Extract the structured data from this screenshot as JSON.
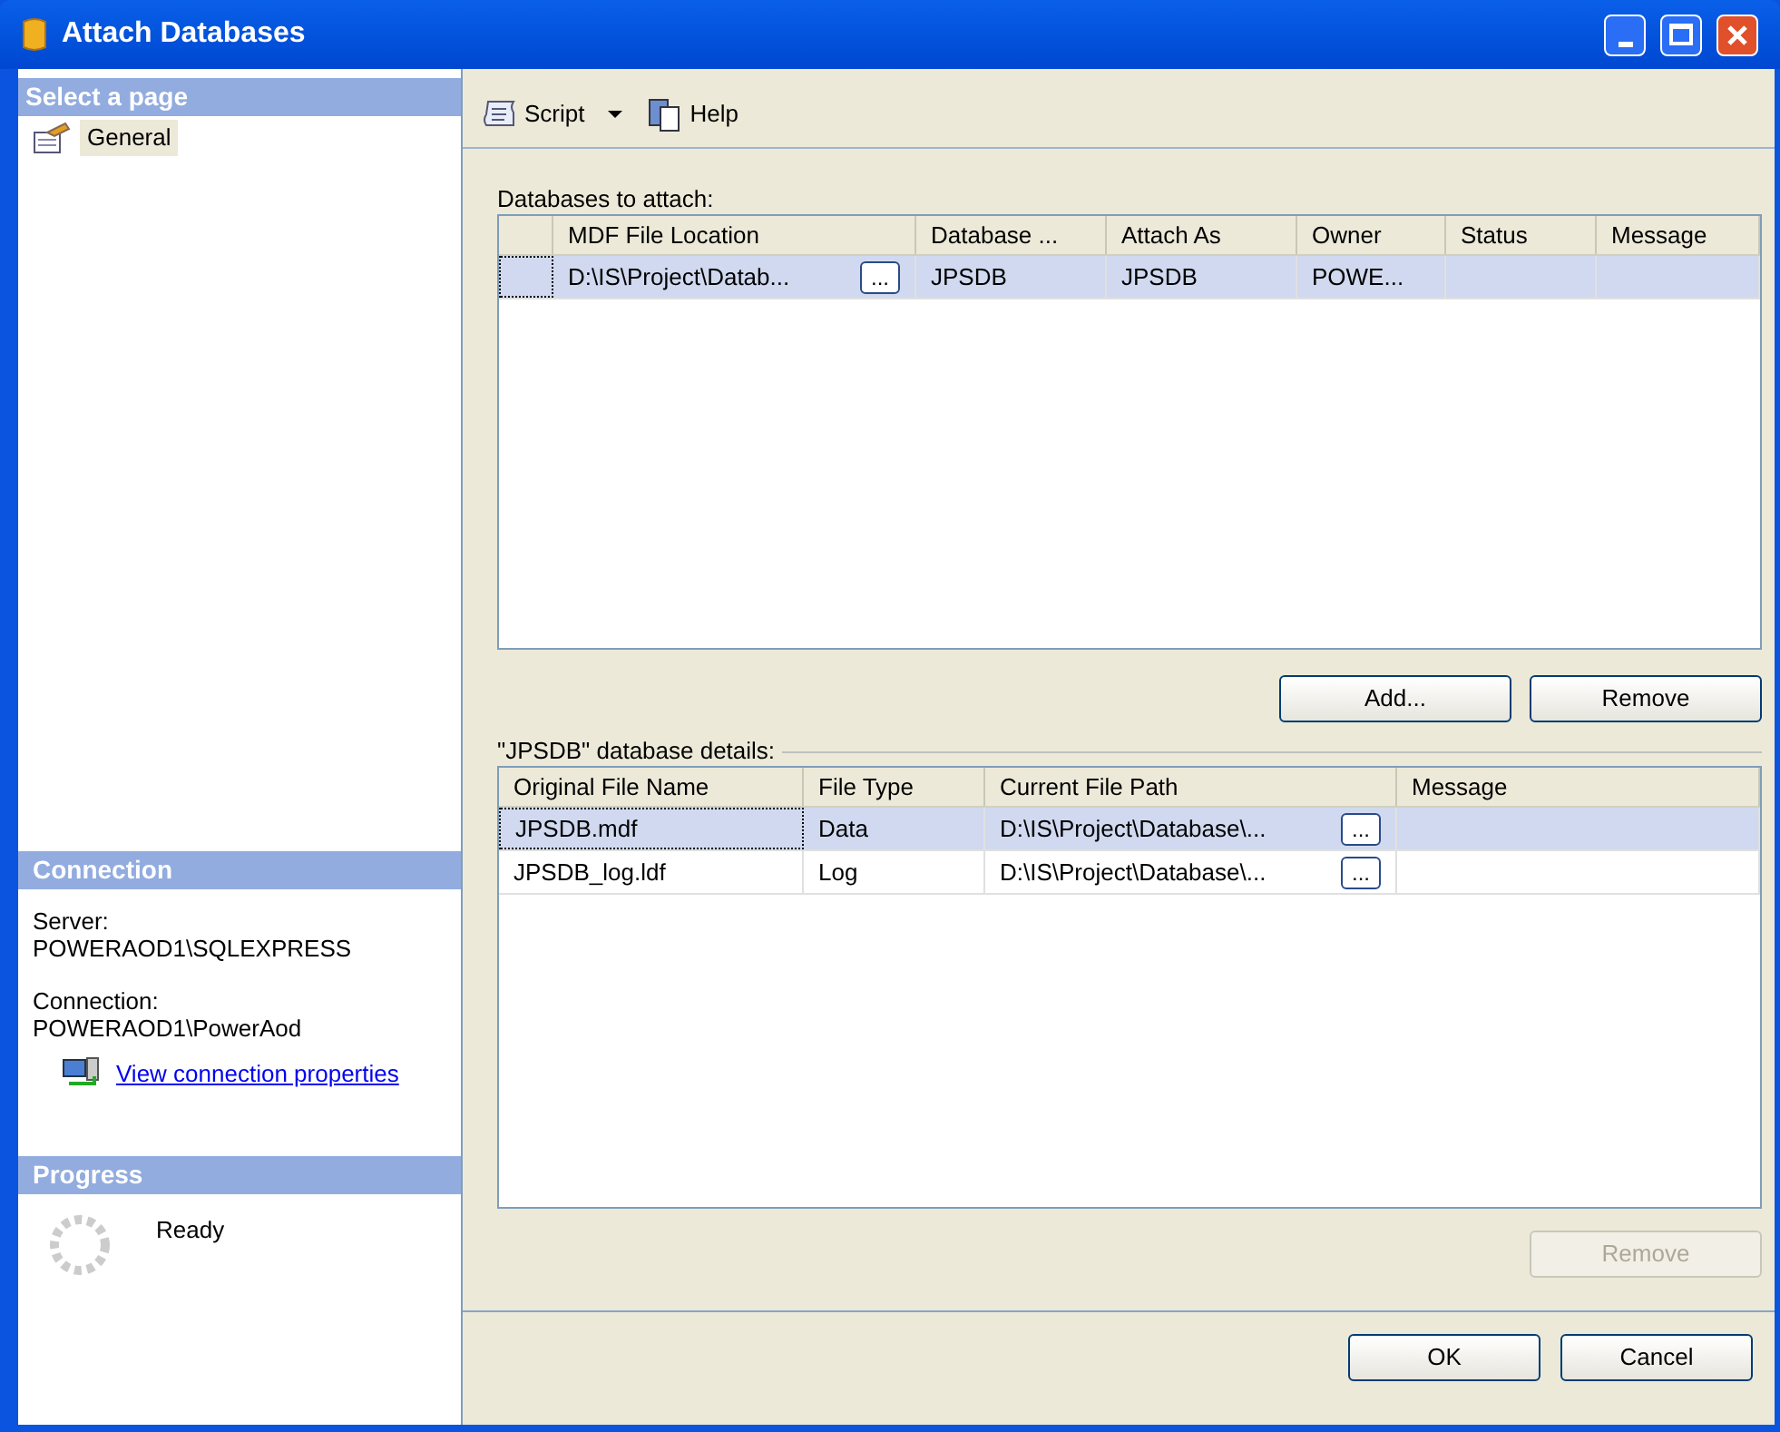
{
  "window": {
    "title": "Attach Databases"
  },
  "sidebar": {
    "header": "Select a page",
    "items": [
      {
        "label": "General",
        "selected": true
      }
    ]
  },
  "connection": {
    "header": "Connection",
    "server_label": "Server:",
    "server": "POWERAOD1\\SQLEXPRESS",
    "connection_label": "Connection:",
    "connection": "POWERAOD1\\PowerAod",
    "link": "View connection properties"
  },
  "progress": {
    "header": "Progress",
    "status": "Ready"
  },
  "toolbar": {
    "script": "Script",
    "help": "Help"
  },
  "databases": {
    "label": "Databases to attach:",
    "columns": [
      "MDF File Location",
      "Database ...",
      "Attach As",
      "Owner",
      "Status",
      "Message"
    ],
    "rows": [
      {
        "selected": true,
        "cells": [
          "D:\\IS\\Project\\Datab...",
          "JPSDB",
          "JPSDB",
          "POWE...",
          "",
          ""
        ],
        "browse": "..."
      }
    ]
  },
  "database_buttons": [
    {
      "label": "Add...",
      "disabled": false
    },
    {
      "label": "Remove",
      "disabled": false
    }
  ],
  "details": {
    "label": "\"JPSDB\" database details:",
    "columns": [
      "Original File Name",
      "File Type",
      "Current File Path",
      "Message"
    ],
    "rows": [
      {
        "selected": true,
        "cells": [
          "JPSDB.mdf",
          "Data",
          "D:\\IS\\Project\\Database\\...",
          ""
        ],
        "browse": "..."
      },
      {
        "selected": false,
        "cells": [
          "JPSDB_log.ldf",
          "Log",
          "D:\\IS\\Project\\Database\\...",
          ""
        ],
        "browse": "..."
      }
    ]
  },
  "details_button": {
    "label": "Remove",
    "disabled": true
  },
  "buttons": [
    "OK",
    "Cancel"
  ]
}
